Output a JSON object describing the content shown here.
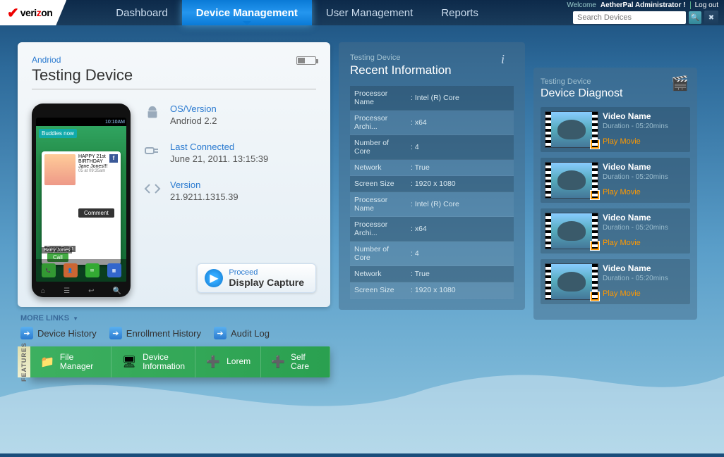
{
  "brand": "verizon",
  "nav": {
    "dashboard": "Dashboard",
    "devicemgmt": "Device Management",
    "usermgmt": "User Management",
    "reports": "Reports"
  },
  "topright": {
    "welcome": "Welcome",
    "admin": "AetherPal Administrator !",
    "logout": "Log out",
    "search_placeholder": "Search Devices"
  },
  "device": {
    "type": "Andriod",
    "name": "Testing Device",
    "os_label": "OS/Version",
    "os_value": "Andriod 2.2",
    "last_label": "Last Connected",
    "last_value": "June 21, 2011. 13:15:39",
    "ver_label": "Version",
    "ver_value": "21.9211.1315.39",
    "proceed": "Proceed",
    "display_capture": "Display Capture",
    "phone": {
      "time": "10:10AM",
      "buddies": "Buddies now",
      "bday": "HAPPY 21st BIRTHDAY Jane Jones!!!",
      "bday_time": "05 at 09:35am",
      "name1": "Dawn Smith",
      "comment": "Comment",
      "call": "Call",
      "name2": "Barry Jones",
      "edit": "Edit",
      "dock": [
        "Phone",
        "Contacts",
        "Messaging",
        "Applications"
      ]
    }
  },
  "more_links": {
    "label": "MORE LINKS",
    "items": [
      "Device History",
      "Enrollment History",
      "Audit Log"
    ]
  },
  "features": {
    "label": "FEATURES",
    "items": [
      "File Manager",
      "Device Information",
      "Lorem",
      "Self Care"
    ]
  },
  "recent": {
    "subhead": "Testing Device",
    "head": "Recent Information",
    "rows": [
      {
        "k": "Processor Name",
        "v": ": Intel (R) Core"
      },
      {
        "k": "Processor Archi...",
        "v": ": x64"
      },
      {
        "k": "Number of Core",
        "v": ": 4"
      },
      {
        "k": "Network",
        "v": ": True"
      },
      {
        "k": "Screen Size",
        "v": ": 1920 x 1080"
      },
      {
        "k": "Processor Name",
        "v": ": Intel (R) Core"
      },
      {
        "k": "Processor Archi...",
        "v": ": x64"
      },
      {
        "k": "Number of Core",
        "v": ": 4"
      },
      {
        "k": "Network",
        "v": ": True"
      },
      {
        "k": "Screen Size",
        "v": ": 1920 x 1080"
      }
    ]
  },
  "diag": {
    "subhead": "Testing Device",
    "head": "Device Diagnost",
    "videos": [
      {
        "title": "Video Name",
        "dur": "Duration - 05:20mins",
        "play": "Play Movie"
      },
      {
        "title": "Video Name",
        "dur": "Duration - 05:20mins",
        "play": "Play Movie"
      },
      {
        "title": "Video Name",
        "dur": "Duration - 05:20mins",
        "play": "Play Movie"
      },
      {
        "title": "Video Name",
        "dur": "Duration - 05:20mins",
        "play": "Play Movie"
      }
    ]
  }
}
